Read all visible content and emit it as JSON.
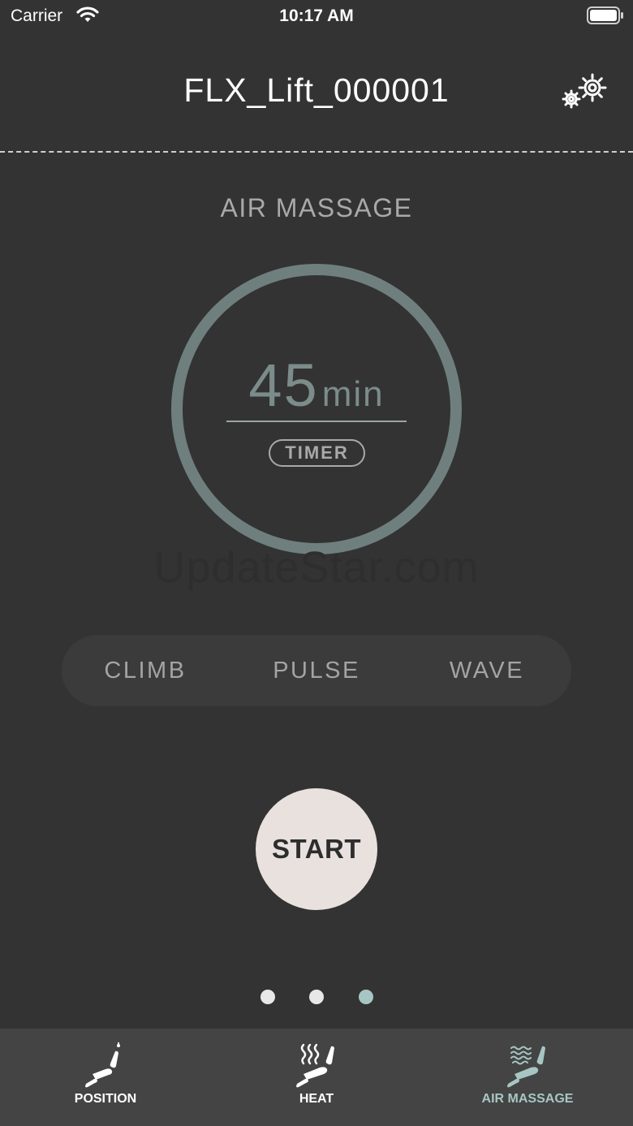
{
  "status_bar": {
    "carrier": "Carrier",
    "time": "10:17 AM"
  },
  "header": {
    "title": "FLX_Lift_000001",
    "settings_icon": "gear-icon"
  },
  "section": {
    "title": "AIR MASSAGE"
  },
  "timer": {
    "value": "45",
    "unit": "min",
    "label": "TIMER"
  },
  "watermark": "UpdateStar.com",
  "modes": [
    {
      "label": "CLIMB"
    },
    {
      "label": "PULSE"
    },
    {
      "label": "WAVE"
    }
  ],
  "start_label": "START",
  "pager": {
    "count": 3,
    "active_index": 2
  },
  "tabs": [
    {
      "label": "POSITION",
      "icon": "recliner-icon",
      "active": false
    },
    {
      "label": "HEAT",
      "icon": "recliner-heat-icon",
      "active": false
    },
    {
      "label": "AIR MASSAGE",
      "icon": "recliner-massage-icon",
      "active": true
    }
  ],
  "colors": {
    "background": "#333333",
    "tab_bar": "#444444",
    "accent": "#a7c6c3",
    "ring": "#6e7f7e",
    "start_button": "#e8e1de"
  }
}
